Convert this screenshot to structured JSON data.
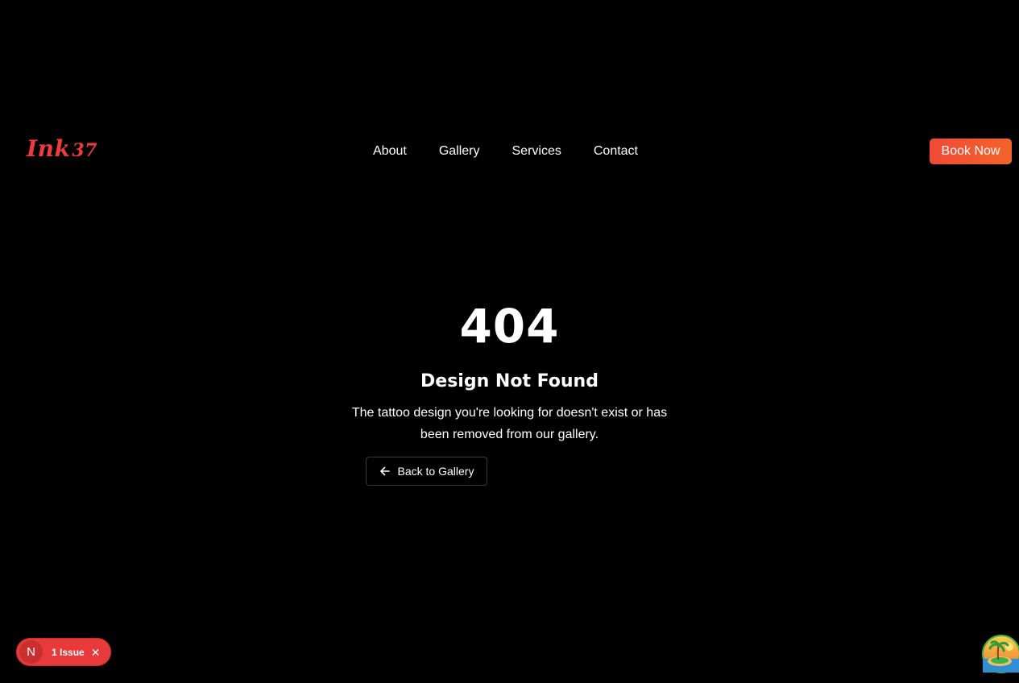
{
  "header": {
    "logo_text": "Ink",
    "logo_number": "37",
    "nav": [
      {
        "label": "About"
      },
      {
        "label": "Gallery"
      },
      {
        "label": "Services"
      },
      {
        "label": "Contact"
      }
    ],
    "cta_label": "Book Now"
  },
  "error": {
    "code": "404",
    "title": "Design Not Found",
    "description": "The tattoo design you're looking for doesn't exist or has been removed from our gallery.",
    "back_label": "Back to Gallery",
    "back_icon": "arrow-left-icon"
  },
  "dev_overlay": {
    "badge_letter": "N",
    "issue_text": "1 Issue",
    "close_glyph": "✕",
    "corner_icon": "island-sunset-icon"
  },
  "colors": {
    "background": "#000000",
    "brand": "#ef3b3b",
    "cta_gradient_start": "#f04a36",
    "cta_gradient_end": "#f5632c",
    "issue_badge": "#e83a3a",
    "text": "#ffffff"
  }
}
